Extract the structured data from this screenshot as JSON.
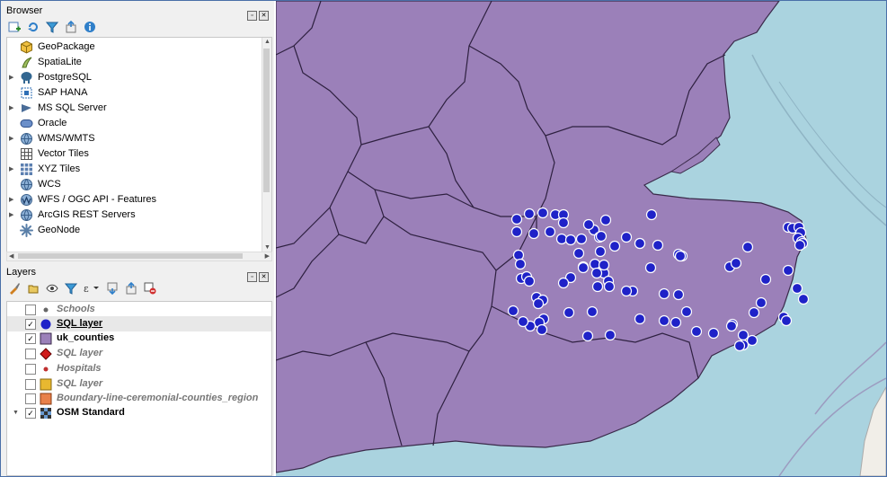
{
  "browser": {
    "title": "Browser",
    "items": [
      {
        "label": "GeoPackage",
        "icon": "geopackage-icon",
        "expandable": false
      },
      {
        "label": "SpatiaLite",
        "icon": "spatialite-icon",
        "expandable": false
      },
      {
        "label": "PostgreSQL",
        "icon": "postgresql-icon",
        "expandable": true
      },
      {
        "label": "SAP HANA",
        "icon": "sap-hana-icon",
        "expandable": false
      },
      {
        "label": "MS SQL Server",
        "icon": "mssql-icon",
        "expandable": true
      },
      {
        "label": "Oracle",
        "icon": "oracle-icon",
        "expandable": false
      },
      {
        "label": "WMS/WMTS",
        "icon": "wms-icon",
        "expandable": true
      },
      {
        "label": "Vector Tiles",
        "icon": "vector-tiles-icon",
        "expandable": false
      },
      {
        "label": "XYZ Tiles",
        "icon": "xyz-tiles-icon",
        "expandable": true
      },
      {
        "label": "WCS",
        "icon": "wcs-icon",
        "expandable": false
      },
      {
        "label": "WFS / OGC API - Features",
        "icon": "wfs-icon",
        "expandable": true
      },
      {
        "label": "ArcGIS REST Servers",
        "icon": "arcgis-icon",
        "expandable": true
      },
      {
        "label": "GeoNode",
        "icon": "geonode-icon",
        "expandable": false
      }
    ]
  },
  "layers": {
    "title": "Layers",
    "items": [
      {
        "label": "Schools",
        "checked": false,
        "symbol": "small-grey-dot"
      },
      {
        "label": "SQL layer",
        "checked": true,
        "symbol": "blue-circle"
      },
      {
        "label": "uk_counties",
        "checked": true,
        "symbol": "purple-fill"
      },
      {
        "label": "SQL layer",
        "checked": false,
        "symbol": "red-diamond"
      },
      {
        "label": "Hospitals",
        "checked": false,
        "symbol": "small-red-dot"
      },
      {
        "label": "SQL layer",
        "checked": false,
        "symbol": "yellow-fill"
      },
      {
        "label": "Boundary-line-ceremonial-counties_region",
        "checked": false,
        "symbol": "orange-fill"
      },
      {
        "label": "OSM Standard",
        "checked": true,
        "symbol": "osm-raster"
      }
    ]
  },
  "colors": {
    "counties_fill": "#9b80b9",
    "county_border": "#3a2a4a",
    "sea": "#aad3df",
    "points_fill": "#1f22c8",
    "panel_bg": "#f0f0f0"
  }
}
